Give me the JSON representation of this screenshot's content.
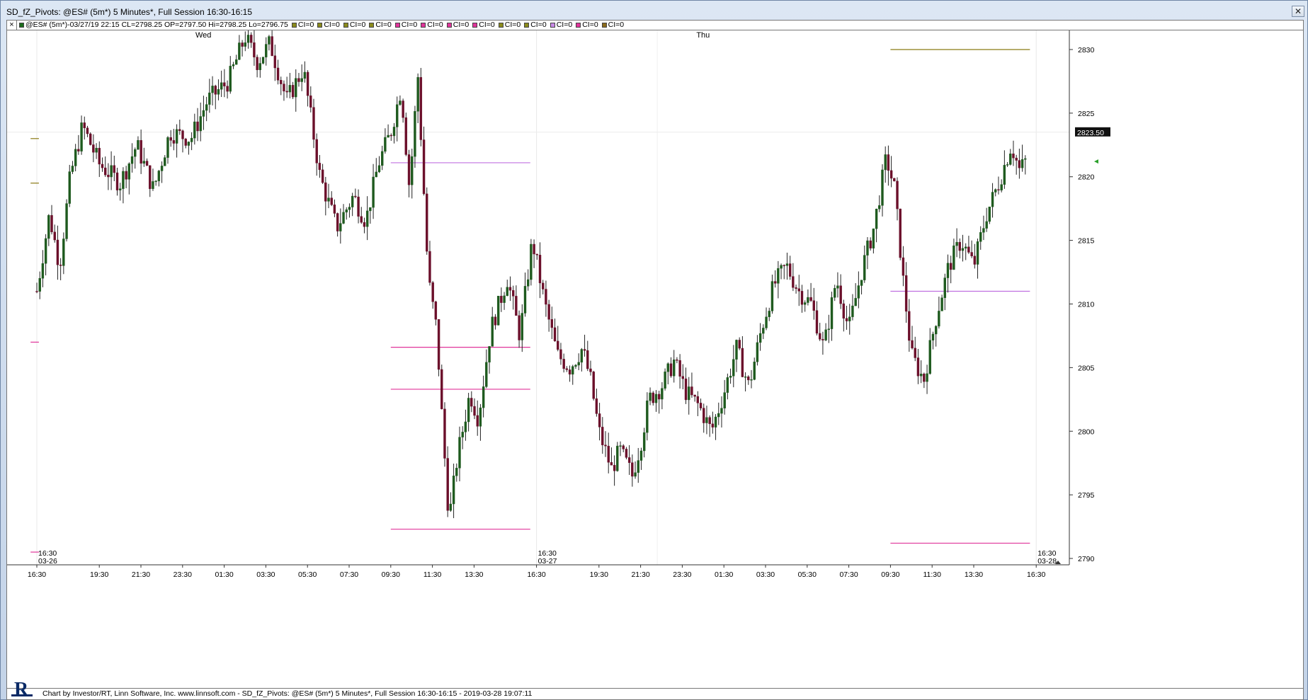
{
  "window": {
    "title": "SD_fZ_Pivots: @ES# (5m*) 5 Minutes*, Full Session 16:30-16:15"
  },
  "infobar": {
    "close_glyph": "×",
    "items": [
      {
        "label": "@ES# (5m*)-03/27/19 22:15 CL=2798.25 OP=2797.50 Hi=2798.25 Lo=2796.75",
        "color": "#1b6b1b"
      },
      {
        "label": "CI=0",
        "color": "#8b8b1c"
      },
      {
        "label": "CI=0",
        "color": "#8b8b1c"
      },
      {
        "label": "CI=0",
        "color": "#8b8b1c"
      },
      {
        "label": "CI=0",
        "color": "#8b8b1c"
      },
      {
        "label": "CI=0",
        "color": "#e0359a"
      },
      {
        "label": "CI=0",
        "color": "#e0359a"
      },
      {
        "label": "CI=0",
        "color": "#e0359a"
      },
      {
        "label": "CI=0",
        "color": "#e0359a"
      },
      {
        "label": "CI=0",
        "color": "#8b8b1c"
      },
      {
        "label": "CI=0",
        "color": "#8b8b1c"
      },
      {
        "label": "CI=0",
        "color": "#c98ae6"
      },
      {
        "label": "CI=0",
        "color": "#e0359a"
      },
      {
        "label": "CI=0",
        "color": "#8b6b1c"
      }
    ]
  },
  "footer": {
    "text": "Chart by Investor/RT, Linn Software, Inc. www.linnsoft.com - SD_fZ_Pivots: @ES# (5m*) 5 Minutes*, Full Session 16:30-16:15 - 2019-03-28 19:07:11",
    "logo_letter": "R"
  },
  "colors": {
    "up_candle": "#1e5a1e",
    "down_candle": "#6b0f2a",
    "pivot_olive": "#8b7a14",
    "pivot_magenta": "#e0359a",
    "pivot_violet": "#c070e0",
    "grid": "#e8e8e8"
  },
  "chart_data": {
    "type": "candlestick",
    "title": "SD_fZ_Pivots: @ES# (5m*) 5 Minutes*, Full Session 16:30-16:15",
    "ylim": [
      2789.5,
      2831.5
    ],
    "y_ticks": [
      2790,
      2795,
      2800,
      2805,
      2810,
      2815,
      2820,
      2825,
      2830
    ],
    "last_price": "2823.50",
    "day_labels": [
      {
        "label": "Wed",
        "time_index": 4
      },
      {
        "label": "Thu",
        "time_index": 16
      }
    ],
    "session_marks": [
      {
        "time": "16:30",
        "date": "03-26",
        "time_index": 0
      },
      {
        "time": "16:30",
        "date": "03-27",
        "time_index": 12
      },
      {
        "time": "16:30",
        "date": "03-28",
        "time_index": 24
      }
    ],
    "x_tick_labels": [
      "16:30",
      "19:30",
      "21:30",
      "23:30",
      "01:30",
      "03:30",
      "05:30",
      "07:30",
      "09:30",
      "11:30",
      "13:30",
      "16:30",
      "19:30",
      "21:30",
      "23:30",
      "01:30",
      "03:30",
      "05:30",
      "07:30",
      "09:30",
      "11:30",
      "13:30",
      "16:30"
    ],
    "x_tick_index": [
      0,
      1.5,
      2.5,
      3.5,
      4.5,
      5.5,
      6.5,
      7.5,
      8.5,
      9.5,
      10.5,
      12,
      13.5,
      14.5,
      15.5,
      16.5,
      17.5,
      18.5,
      19.5,
      20.5,
      21.5,
      22.5,
      24
    ],
    "price_path": [
      {
        "t": 0,
        "p": 2811
      },
      {
        "t": 0.3,
        "p": 2817
      },
      {
        "t": 0.55,
        "p": 2813
      },
      {
        "t": 0.8,
        "p": 2820
      },
      {
        "t": 1.1,
        "p": 2824
      },
      {
        "t": 1.5,
        "p": 2821
      },
      {
        "t": 2.0,
        "p": 2819.5
      },
      {
        "t": 2.4,
        "p": 2822.5
      },
      {
        "t": 2.8,
        "p": 2819
      },
      {
        "t": 3.2,
        "p": 2823.5
      },
      {
        "t": 3.7,
        "p": 2823
      },
      {
        "t": 4.1,
        "p": 2826
      },
      {
        "t": 4.6,
        "p": 2827.5
      },
      {
        "t": 5.0,
        "p": 2831
      },
      {
        "t": 5.3,
        "p": 2829
      },
      {
        "t": 5.6,
        "p": 2830.5
      },
      {
        "t": 6.0,
        "p": 2826
      },
      {
        "t": 6.4,
        "p": 2828.5
      },
      {
        "t": 6.8,
        "p": 2820
      },
      {
        "t": 7.2,
        "p": 2816
      },
      {
        "t": 7.6,
        "p": 2818.5
      },
      {
        "t": 7.9,
        "p": 2816.5
      },
      {
        "t": 8.2,
        "p": 2821
      },
      {
        "t": 8.5,
        "p": 2823.5
      },
      {
        "t": 8.75,
        "p": 2827
      },
      {
        "t": 8.95,
        "p": 2819
      },
      {
        "t": 9.15,
        "p": 2828
      },
      {
        "t": 9.4,
        "p": 2812
      },
      {
        "t": 9.6,
        "p": 2808
      },
      {
        "t": 9.75,
        "p": 2800
      },
      {
        "t": 9.9,
        "p": 2793
      },
      {
        "t": 10.1,
        "p": 2798
      },
      {
        "t": 10.4,
        "p": 2803
      },
      {
        "t": 10.6,
        "p": 2801
      },
      {
        "t": 10.9,
        "p": 2808
      },
      {
        "t": 11.3,
        "p": 2812
      },
      {
        "t": 11.6,
        "p": 2807.5
      },
      {
        "t": 11.9,
        "p": 2815
      },
      {
        "t": 12.2,
        "p": 2810
      },
      {
        "t": 12.5,
        "p": 2806
      },
      {
        "t": 12.8,
        "p": 2805
      },
      {
        "t": 13.1,
        "p": 2806.5
      },
      {
        "t": 13.3,
        "p": 2804
      },
      {
        "t": 13.5,
        "p": 2800
      },
      {
        "t": 13.8,
        "p": 2797
      },
      {
        "t": 14.0,
        "p": 2798.5
      },
      {
        "t": 14.3,
        "p": 2796.5
      },
      {
        "t": 14.5,
        "p": 2799
      },
      {
        "t": 14.7,
        "p": 2802.5
      },
      {
        "t": 15.0,
        "p": 2803.5
      },
      {
        "t": 15.3,
        "p": 2805.5
      },
      {
        "t": 15.6,
        "p": 2803
      },
      {
        "t": 15.9,
        "p": 2802
      },
      {
        "t": 16.2,
        "p": 2800
      },
      {
        "t": 16.5,
        "p": 2803
      },
      {
        "t": 16.8,
        "p": 2806.5
      },
      {
        "t": 17.1,
        "p": 2803.5
      },
      {
        "t": 17.4,
        "p": 2808
      },
      {
        "t": 17.7,
        "p": 2811.5
      },
      {
        "t": 18.0,
        "p": 2813
      },
      {
        "t": 18.3,
        "p": 2811
      },
      {
        "t": 18.6,
        "p": 2810
      },
      {
        "t": 18.9,
        "p": 2806.5
      },
      {
        "t": 19.2,
        "p": 2812
      },
      {
        "t": 19.5,
        "p": 2808
      },
      {
        "t": 19.8,
        "p": 2812.5
      },
      {
        "t": 20.1,
        "p": 2816
      },
      {
        "t": 20.4,
        "p": 2821.5
      },
      {
        "t": 20.6,
        "p": 2819
      },
      {
        "t": 20.8,
        "p": 2812
      },
      {
        "t": 21.0,
        "p": 2806
      },
      {
        "t": 21.3,
        "p": 2804
      },
      {
        "t": 21.6,
        "p": 2809
      },
      {
        "t": 21.9,
        "p": 2813
      },
      {
        "t": 22.2,
        "p": 2815
      },
      {
        "t": 22.5,
        "p": 2813
      },
      {
        "t": 22.8,
        "p": 2817
      },
      {
        "t": 23.1,
        "p": 2819.5
      },
      {
        "t": 23.4,
        "p": 2822.5
      },
      {
        "t": 23.6,
        "p": 2820.5
      },
      {
        "t": 23.8,
        "p": 2821.5
      }
    ],
    "pivot_lines": [
      {
        "price": 2823.0,
        "t0": -0.15,
        "t1": 0.05,
        "color": "olive"
      },
      {
        "price": 2819.5,
        "t0": -0.15,
        "t1": 0.05,
        "color": "olive"
      },
      {
        "price": 2807.0,
        "t0": -0.15,
        "t1": 0.05,
        "color": "magenta"
      },
      {
        "price": 2790.5,
        "t0": -0.15,
        "t1": 0.05,
        "color": "magenta"
      },
      {
        "price": 2821.1,
        "t0": 8.5,
        "t1": 11.85,
        "color": "violet"
      },
      {
        "price": 2806.6,
        "t0": 8.5,
        "t1": 11.85,
        "color": "magenta"
      },
      {
        "price": 2803.3,
        "t0": 8.5,
        "t1": 11.85,
        "color": "magenta"
      },
      {
        "price": 2792.3,
        "t0": 8.5,
        "t1": 11.85,
        "color": "magenta"
      },
      {
        "price": 2830.0,
        "t0": 20.5,
        "t1": 23.85,
        "color": "olive"
      },
      {
        "price": 2811.0,
        "t0": 20.5,
        "t1": 23.85,
        "color": "violet"
      },
      {
        "price": 2791.2,
        "t0": 20.5,
        "t1": 23.85,
        "color": "magenta"
      }
    ]
  }
}
